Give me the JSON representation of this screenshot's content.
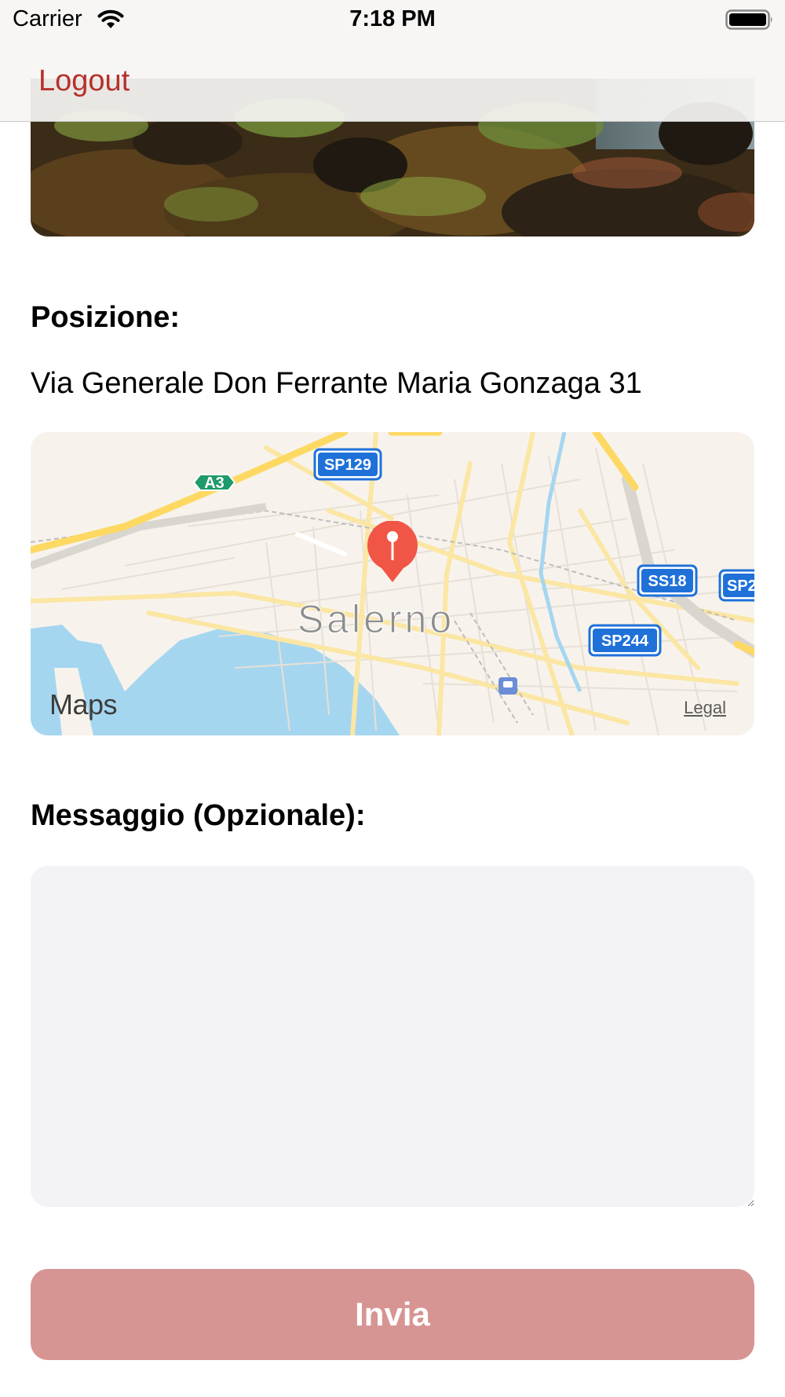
{
  "status_bar": {
    "carrier": "Carrier",
    "time": "7:18 PM",
    "wifi_icon": "wifi-icon",
    "battery_icon": "battery-icon"
  },
  "nav": {
    "logout_label": "Logout"
  },
  "colors": {
    "accent": "#b6302b",
    "send_button": "#d69593",
    "text_area_bg": "#f2f2f7",
    "pin": "#f15545",
    "water": "#a5d6f0",
    "road_major": "#fdd964",
    "shield": "#1f71d8",
    "highway_shield": "#1f9a6a"
  },
  "location": {
    "label": "Posizione:",
    "address": "Via Generale Don Ferrante Maria Gonzaga 31"
  },
  "map": {
    "city_label": "Salerno",
    "shields": [
      "SP129",
      "A3",
      "SS18",
      "SP2",
      "SP244"
    ],
    "maps_label": "Maps",
    "legal_label": "Legal",
    "pin_icon": "map-pin-icon"
  },
  "message": {
    "label": "Messaggio (Opzionale):",
    "value": "",
    "placeholder": ""
  },
  "send_button": {
    "label": "Invia"
  }
}
